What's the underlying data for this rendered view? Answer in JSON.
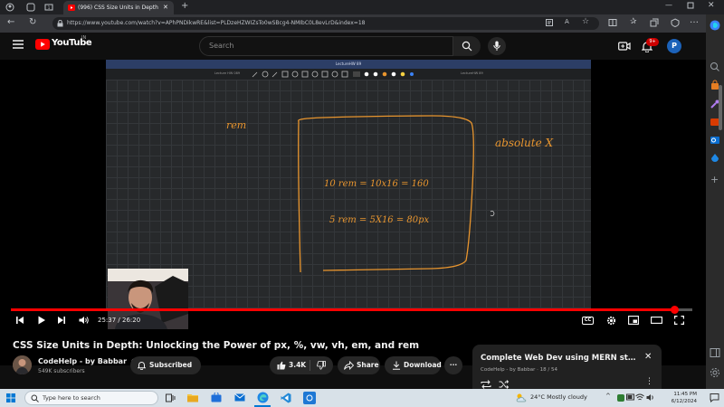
{
  "browser": {
    "tab_title": "(996) CSS Size Units in Depth",
    "tab_count": "1",
    "url": "https://www.youtube.com/watch?v=APhPNDikwRE&list=PLDzeHZWIZsTo0wSBcg4-NMIbC0L8evLrD&index=18"
  },
  "youtube": {
    "logo_text": "YouTube",
    "region": "IN",
    "search_placeholder": "Search",
    "notifications_badge": "9+",
    "avatar_letter": "P"
  },
  "player": {
    "whiteboard_app": "LectureHW 89",
    "canvas_tab_left": "Lecture HW 089",
    "canvas_tab_right": "LectureHW 89",
    "handwritten_rem": "rem",
    "handwritten_absolute": "absolute X",
    "handwritten_line1": "10 rem = 10x16 = 160",
    "handwritten_line2": "5 rem = 5X16 = 80px",
    "current_time": "25:37",
    "duration": "26:20",
    "progress_fraction": 0.9728,
    "cc_label": "CC"
  },
  "video": {
    "title": "CSS Size Units in Depth: Unlocking the Power of px, %, vw, vh, em, and rem",
    "channel_name": "CodeHelp - by Babbar",
    "subscribers": "549K subscribers",
    "subscribed_label": "Subscribed",
    "likes": "3.4K",
    "share_label": "Share",
    "download_label": "Download"
  },
  "playlist": {
    "title": "Complete Web Dev using MERN stac...",
    "meta": "CodeHelp - by Babbar · 18 / 54"
  },
  "taskbar": {
    "search_placeholder": "Type here to search",
    "weather": "24°C  Mostly cloudy",
    "time": "11:45 PM",
    "date": "6/12/2024"
  },
  "colors": {
    "yt_red": "#ff0000",
    "ink_orange": "#e8952e",
    "avatar_blue": "#1c62b9",
    "edge_accent": "#0a84ff"
  }
}
